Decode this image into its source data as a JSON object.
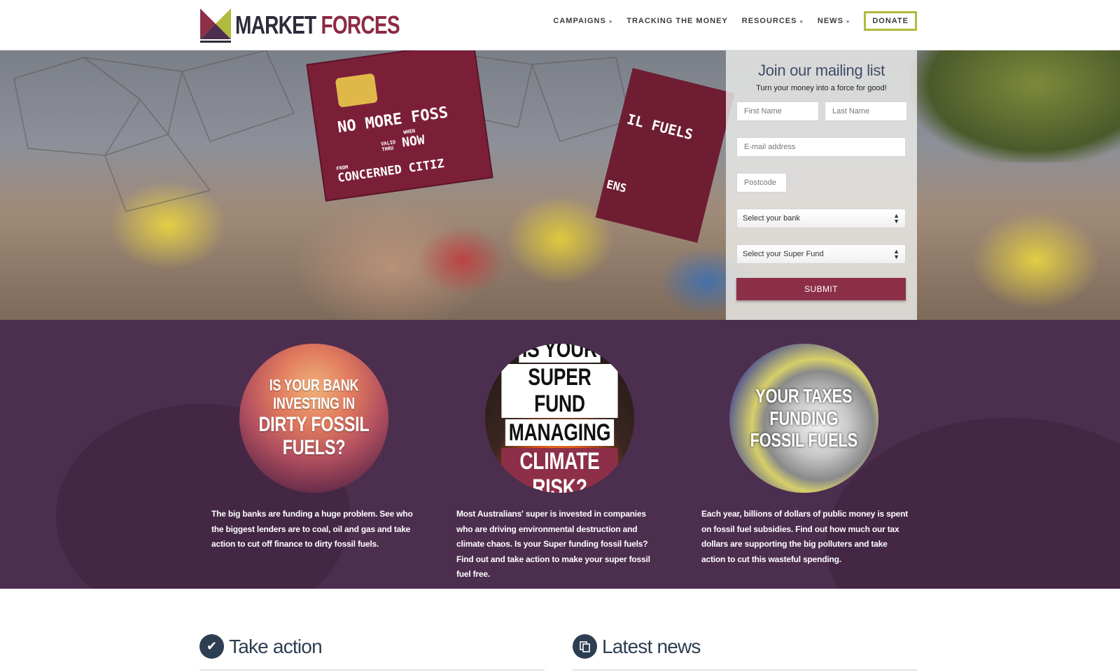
{
  "header": {
    "logo_word1": "MARKET",
    "logo_word2": "FORCES",
    "nav": [
      {
        "label": "CAMPAIGNS",
        "dropdown": true
      },
      {
        "label": "TRACKING THE MONEY",
        "dropdown": false
      },
      {
        "label": "RESOURCES",
        "dropdown": true
      },
      {
        "label": "NEWS",
        "dropdown": true
      }
    ],
    "donate_label": "DONATE"
  },
  "hero": {
    "sign1_line1": "NO MORE FOSS",
    "sign1_valid": "VALID THRU",
    "sign1_when": "WHEN",
    "sign1_now": "NOW",
    "sign1_from": "FROM",
    "sign1_line3": "CONCERNED CITIZ",
    "sign2_line": "IL FUELS",
    "sign2_line2": "ENS"
  },
  "form": {
    "title": "Join our mailing list",
    "subtitle": "Turn your money into a force for good!",
    "first_name_placeholder": "First Name",
    "last_name_placeholder": "Last Name",
    "email_placeholder": "E-mail address",
    "postcode_placeholder": "Postcode",
    "bank_select": "Select your bank",
    "super_select": "Select your Super Fund",
    "submit_label": "SUBMIT"
  },
  "campaigns": [
    {
      "circle_line1": "IS YOUR BANK INVESTING IN",
      "circle_line2": "DIRTY FOSSIL FUELS?",
      "text": "The big banks are funding a huge problem. See who the biggest lenders are to coal, oil and gas and take action to cut off finance to dirty fossil fuels."
    },
    {
      "circle_line1": "IS YOUR",
      "circle_line2": "SUPER FUND",
      "circle_line3": "MANAGING",
      "circle_line4": "CLIMATE RISK?",
      "text": "Most Australians' super is invested in companies who are driving environmental destruction and climate chaos. Is your Super funding fossil fuels? Find out and take action to make your super fossil fuel free."
    },
    {
      "circle_line1": "YOUR TAXES",
      "circle_line2": "FUNDING",
      "circle_line3": "FOSSIL FUELS",
      "text": "Each year, billions of dollars of public money is spent on fossil fuel subsidies. Find out how much our tax dollars are supporting the big polluters and take action to cut this wasteful spending."
    }
  ],
  "sections": {
    "take_action": "Take action",
    "latest_news": "Latest news"
  },
  "colors": {
    "brand_purple": "#4c2e4f",
    "brand_maroon": "#8e2f49",
    "donate_border": "#b2ba3e",
    "heading_navy": "#2d3e52"
  }
}
